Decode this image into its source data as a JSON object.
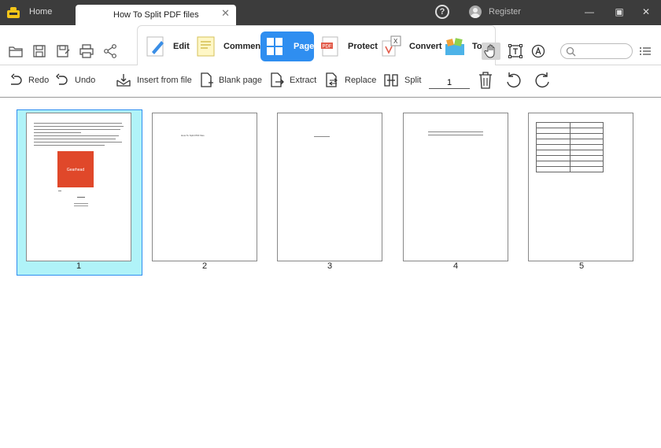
{
  "titlebar": {
    "home_tab": "Home",
    "doc_tab_title": "How To Split PDF files",
    "doc_tab_close": "✕",
    "help": "?",
    "register": "Register",
    "minimize": "—",
    "maximize": "▣",
    "close": "✕"
  },
  "modes": [
    {
      "label": "Edit"
    },
    {
      "label": "Comment"
    },
    {
      "label": "Page"
    },
    {
      "label": "Protect"
    },
    {
      "label": "Convert"
    },
    {
      "label": "To"
    }
  ],
  "colors": {
    "accent": "#2f8ef0",
    "selected_bg": "#b0f3f8",
    "titlebar": "#3c3c3c"
  },
  "page_toolbar": {
    "redo": "Redo",
    "undo": "Undo",
    "insert_from_file": "Insert from file",
    "blank_page": "Blank page",
    "extract": "Extract",
    "replace": "Replace",
    "split": "Split",
    "split_value": "1"
  },
  "thumbnails": [
    {
      "number": "1",
      "selected": true
    },
    {
      "number": "2",
      "selected": false
    },
    {
      "number": "3",
      "selected": false
    },
    {
      "number": "4",
      "selected": false
    },
    {
      "number": "5",
      "selected": false
    }
  ],
  "page_contents": {
    "p1_logo": "Gearhead",
    "p2_title": "How To Split PDF files"
  }
}
